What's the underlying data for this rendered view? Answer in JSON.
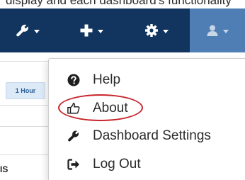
{
  "top_caption": "display and each dashboard's functionality",
  "navbar": {
    "tools_icon": "wrench-icon",
    "add_icon": "plus-icon",
    "settings_icon": "gear-icon",
    "user_icon": "user-icon",
    "bg_color": "#11355e",
    "user_bg_color": "#4e7eb3"
  },
  "background": {
    "time_button": "1 Hour",
    "status_fragment": "IS"
  },
  "user_menu": {
    "items": [
      {
        "label": "Help",
        "icon": "question-circle-icon"
      },
      {
        "label": "About",
        "icon": "thumbs-up-icon"
      },
      {
        "label": "Dashboard Settings",
        "icon": "wrench-icon"
      },
      {
        "label": "Log Out",
        "icon": "sign-out-icon"
      }
    ],
    "highlight_color": "#c8242b"
  }
}
